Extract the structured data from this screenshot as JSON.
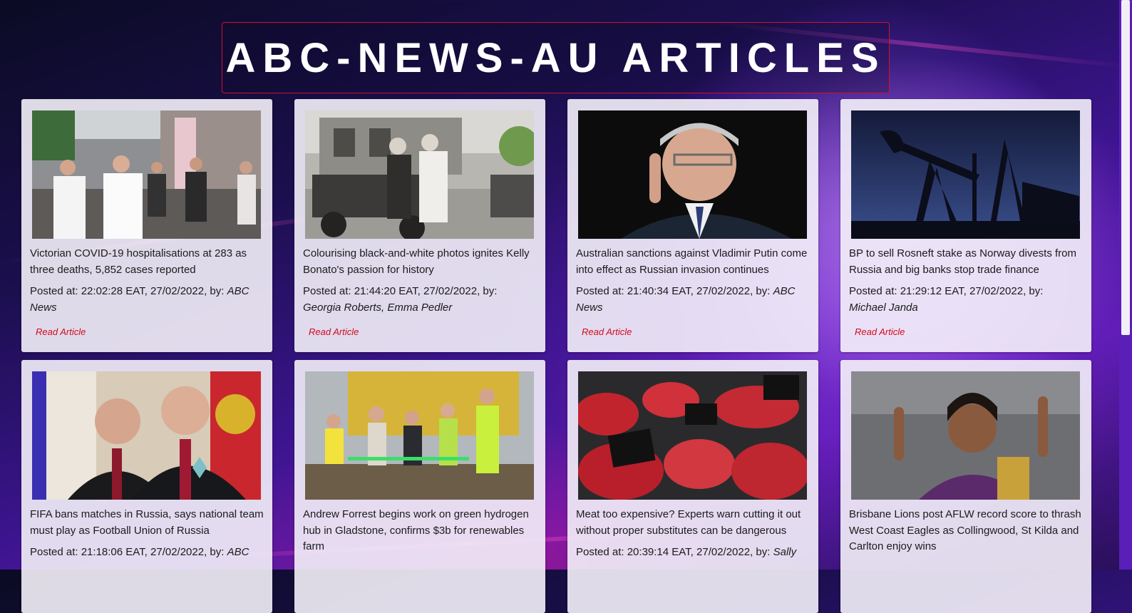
{
  "page": {
    "title": "ABC-NEWS-AU ARTICLES"
  },
  "labels": {
    "posted_at": "Posted at:",
    "by": ", by:",
    "read_article": "Read Article"
  },
  "articles": [
    {
      "headline": "Victorian COVID-19 hospitalisations at 283 as three deaths, 5,852 cases reported",
      "posted": "22:02:28 EAT, 27/02/2022",
      "author": "ABC News"
    },
    {
      "headline": "Colourising black-and-white photos ignites Kelly Bonato's passion for history",
      "posted": "21:44:20 EAT, 27/02/2022",
      "author": "Georgia Roberts, Emma Pedler"
    },
    {
      "headline": "Australian sanctions against Vladimir Putin come into effect as Russian invasion continues",
      "posted": "21:40:34 EAT, 27/02/2022",
      "author": "ABC News"
    },
    {
      "headline": "BP to sell Rosneft stake as Norway divests from Russia and big banks stop trade finance",
      "posted": "21:29:12 EAT, 27/02/2022",
      "author": "Michael Janda"
    },
    {
      "headline": "FIFA bans matches in Russia, says national team must play as Football Union of Russia",
      "posted": "21:18:06 EAT, 27/02/2022",
      "author": "ABC"
    },
    {
      "headline": "Andrew Forrest begins work on green hydrogen hub in Gladstone, confirms $3b for renewables farm",
      "posted": "",
      "author": ""
    },
    {
      "headline": "Meat too expensive? Experts warn cutting it out without proper substitutes can be dangerous",
      "posted": "20:39:14 EAT, 27/02/2022",
      "author": "Sally"
    },
    {
      "headline": "Brisbane Lions post AFLW record score to thrash West Coast Eagles as Collingwood, St Kilda and Carlton enjoy wins",
      "posted": "",
      "author": ""
    }
  ]
}
